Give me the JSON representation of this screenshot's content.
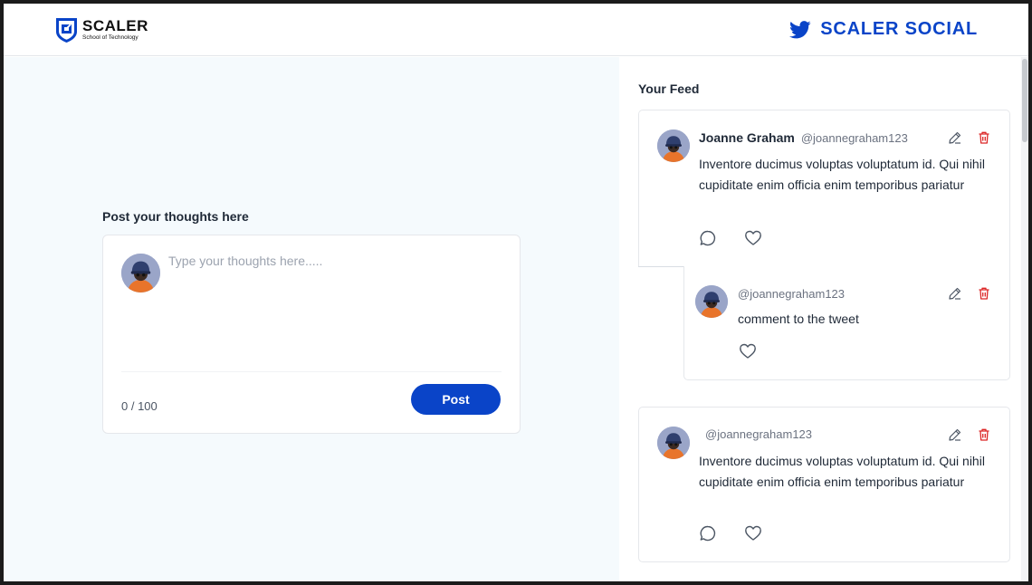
{
  "header": {
    "logo_title": "SCALER",
    "logo_subtitle": "School of Technology",
    "brand_title": "SCALER SOCIAL",
    "brand_color": "#0a44c8"
  },
  "compose": {
    "heading": "Post your thoughts here",
    "placeholder": "Type your thoughts here.....",
    "value": "",
    "counter": "0 / 100",
    "post_label": "Post"
  },
  "feed": {
    "heading": "Your Feed",
    "posts": [
      {
        "name": "Joanne Graham",
        "handle": "@joannegraham123",
        "text": "Inventore ducimus voluptas voluptatum id. Qui nihil cupiditate enim officia enim temporibus pariatur",
        "comment": {
          "handle": "@joannegraham123",
          "text": "comment to the tweet"
        }
      },
      {
        "name": "",
        "handle": "@joannegraham123",
        "text": "Inventore ducimus voluptas voluptatum id. Qui nihil cupiditate enim officia enim temporibus pariatur"
      }
    ]
  },
  "icons": [
    "scaler-shield-icon",
    "twitter-bird-icon",
    "avatar",
    "comment-icon",
    "heart-icon",
    "edit-icon",
    "delete-icon"
  ],
  "colors": {
    "accent": "#0a44c8",
    "delete": "#dc2626",
    "left_bg": "#f5fafd"
  }
}
